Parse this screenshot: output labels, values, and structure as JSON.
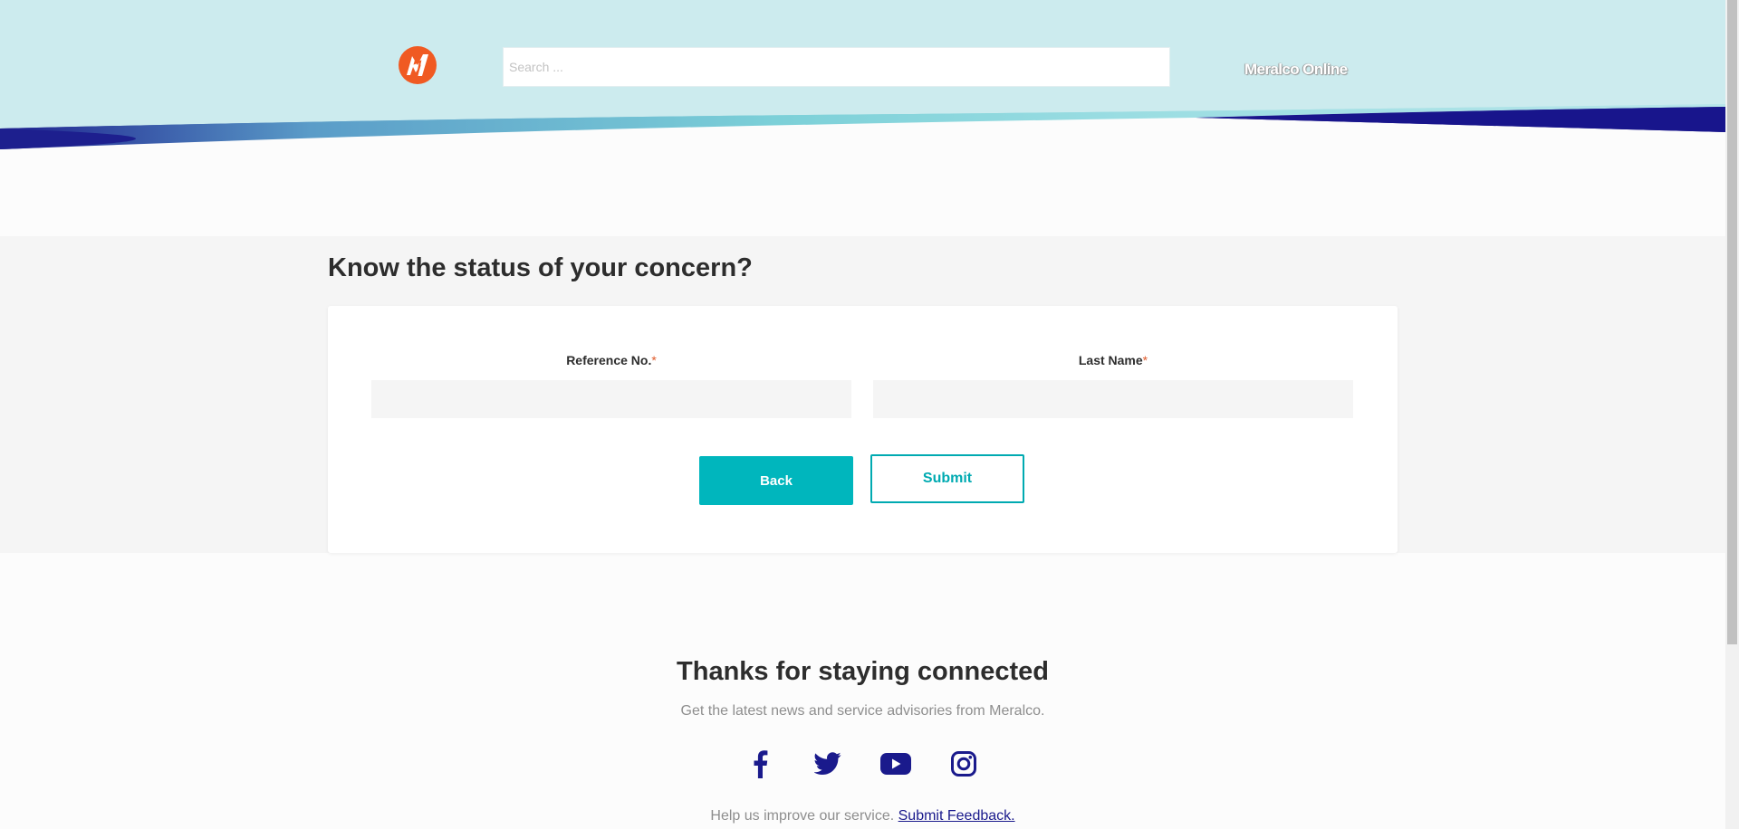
{
  "header": {
    "search_placeholder": "Search ...",
    "online_link": "Meralco Online"
  },
  "status": {
    "title": "Know the status of your concern?",
    "reference_label": "Reference No.",
    "last_name_label": "Last Name",
    "required_mark": "*",
    "back_button": "Back",
    "submit_button": "Submit"
  },
  "footer": {
    "title": "Thanks for staying connected",
    "subtitle": "Get the latest news and service advisories from Meralco.",
    "feedback_text": "Help us improve our service.",
    "feedback_link": "Submit Feedback."
  },
  "colors": {
    "header_bg": "#ccebee",
    "accent_teal": "#00b6bd",
    "navy": "#1a1a8c",
    "brand_orange": "#f05a22"
  },
  "icons": [
    "meralco-logo-icon",
    "facebook-icon",
    "twitter-icon",
    "youtube-icon",
    "instagram-icon"
  ]
}
